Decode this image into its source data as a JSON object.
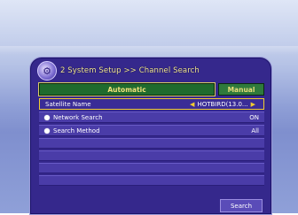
{
  "header": {
    "title": "2  System Setup >> Channel Search",
    "icon": "setup-icon"
  },
  "tabs": [
    {
      "label": "Automatic",
      "active": true
    },
    {
      "label": "Manual",
      "active": false
    }
  ],
  "rows": [
    {
      "label": "Satellite Name",
      "value": "HOTBIRD(13.0...",
      "selected": true
    },
    {
      "label": "Network Search",
      "value": "ON",
      "selected": false
    },
    {
      "label": "Search Method",
      "value": "All",
      "selected": false
    }
  ],
  "buttons": {
    "search": "Search"
  },
  "colors": {
    "panel": "#35288c",
    "tab_active": "#1f6b2e",
    "tab_text": "#f2e07a",
    "highlight": "#f0cc30"
  }
}
